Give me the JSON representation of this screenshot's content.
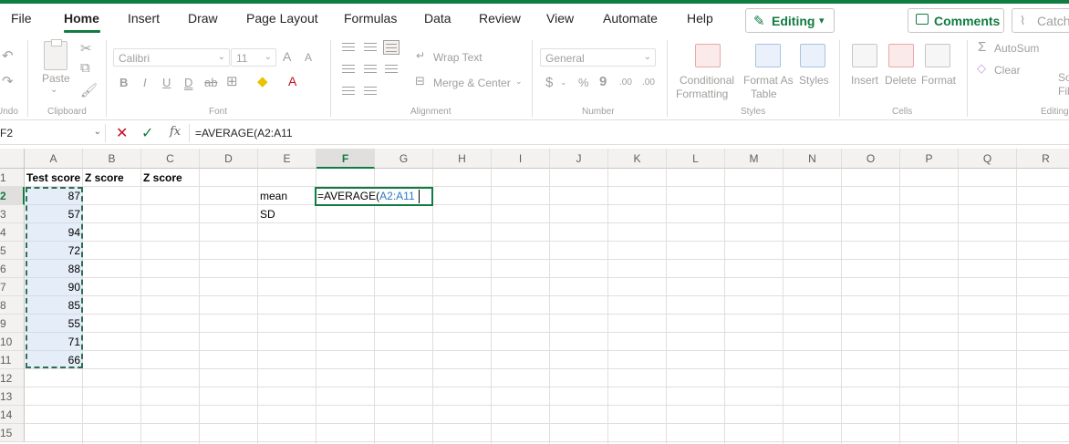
{
  "menu": {
    "tabs": [
      "File",
      "Home",
      "Insert",
      "Draw",
      "Page Layout",
      "Formulas",
      "Data",
      "Review",
      "View",
      "Automate",
      "Help"
    ],
    "active_tab": "Home",
    "editing_label": "Editing",
    "comments_label": "Comments",
    "catchup_label": "Catch"
  },
  "ribbon": {
    "undo_label": "Undo",
    "clipboard": {
      "paste": "Paste",
      "group": "Clipboard"
    },
    "font": {
      "name": "Calibri",
      "size": "11",
      "grow": "A",
      "shrink": "A",
      "bold": "B",
      "italic": "I",
      "underline": "U",
      "double_underline": "D",
      "strikethrough": "ab",
      "group": "Font"
    },
    "alignment": {
      "wrap_text": "Wrap Text",
      "merge_center": "Merge & Center",
      "group": "Alignment"
    },
    "number": {
      "format": "General",
      "currency": "$",
      "percent": "%",
      "comma": "9",
      "inc_decimal": ".00",
      "dec_decimal": ".00",
      "group": "Number"
    },
    "styles": {
      "conditional_1": "Conditional",
      "conditional_2": "Formatting",
      "format_as_1": "Format As",
      "format_as_2": "Table",
      "styles": "Styles",
      "group": "Styles"
    },
    "cells": {
      "insert": "Insert",
      "delete": "Delete",
      "format": "Format",
      "group": "Cells"
    },
    "editing": {
      "autosum": "AutoSum",
      "clear": "Clear",
      "sort_1": "So",
      "sort_2": "Fil",
      "group": "Editing"
    }
  },
  "formula_bar": {
    "name_box": "F2",
    "formula": "=AVERAGE(A2:A11"
  },
  "sheet": {
    "columns": [
      "A",
      "B",
      "C",
      "D",
      "E",
      "F",
      "G",
      "H",
      "I",
      "J",
      "K",
      "L",
      "M",
      "N",
      "O",
      "P",
      "Q",
      "R"
    ],
    "rows": [
      "1",
      "2",
      "3",
      "4",
      "5",
      "6",
      "7",
      "8",
      "9",
      "10",
      "11",
      "12",
      "13",
      "14",
      "15"
    ],
    "selected_column": "F",
    "selected_row": "2",
    "headers": {
      "A1": "Test score",
      "B1": "Z score",
      "C1": "Z score"
    },
    "labels": {
      "E2": "mean",
      "E3": "SD"
    },
    "test_scores": [
      "87",
      "57",
      "94",
      "72",
      "88",
      "90",
      "85",
      "55",
      "71",
      "66"
    ],
    "edit": {
      "prefix": "=AVERAGE(",
      "ref": "A2:A11"
    }
  }
}
